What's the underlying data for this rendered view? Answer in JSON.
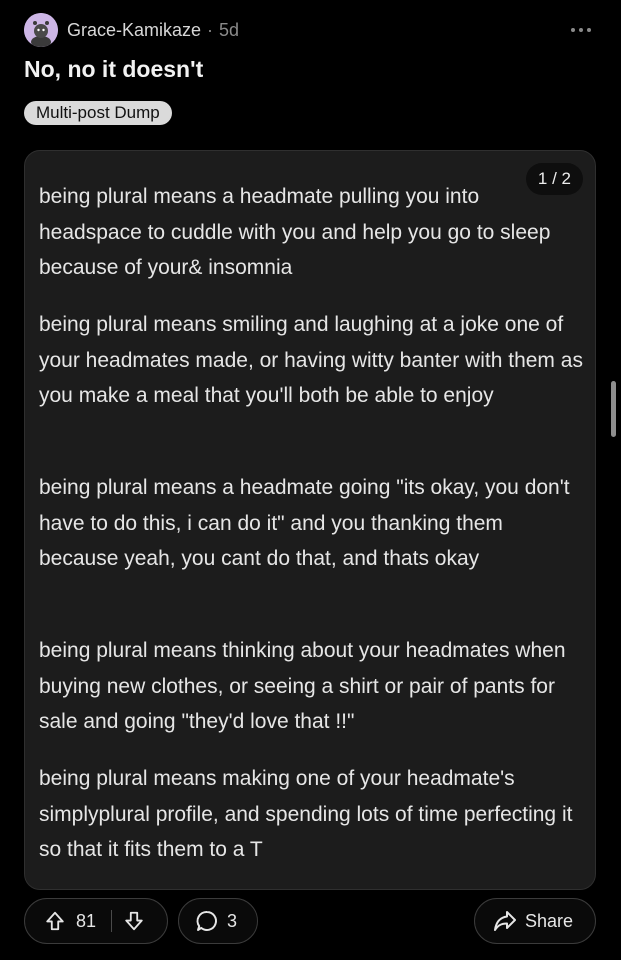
{
  "post": {
    "author": "Grace-Kamikaze",
    "separator": "·",
    "age": "5d",
    "title": "No, no it doesn't",
    "flair": "Multi-post Dump"
  },
  "gallery": {
    "page_indicator": "1 / 2",
    "paragraphs": [
      "being plural means a headmate pulling you into headspace to cuddle with you and help you go to sleep because of your& insomnia",
      "being plural means smiling and laughing at a joke one of your headmates made, or having witty banter with them as you make a meal that you'll both be able to enjoy",
      "being plural means a headmate going \"its okay, you don't have to do this, i can do it\" and you thanking them because yeah, you cant do that, and thats okay",
      "being plural means thinking about your headmates when buying new clothes, or seeing a shirt or pair of pants for sale and going \"they'd love that !!\"",
      "being plural means making one of your headmate's simplyplural profile, and spending lots of time perfecting it so that it fits them to a T"
    ]
  },
  "actions": {
    "upvotes": "81",
    "comments": "3",
    "share_label": "Share"
  },
  "icons": {
    "more": "more-horizontal-icon",
    "upvote": "arrow-up-icon",
    "downvote": "arrow-down-icon",
    "comment": "comment-bubble-icon",
    "share": "share-arrow-icon"
  },
  "colors": {
    "background": "#000000",
    "card": "#1c1c1c",
    "flair_bg": "#dadada",
    "avatar": "#cdb6e6"
  }
}
